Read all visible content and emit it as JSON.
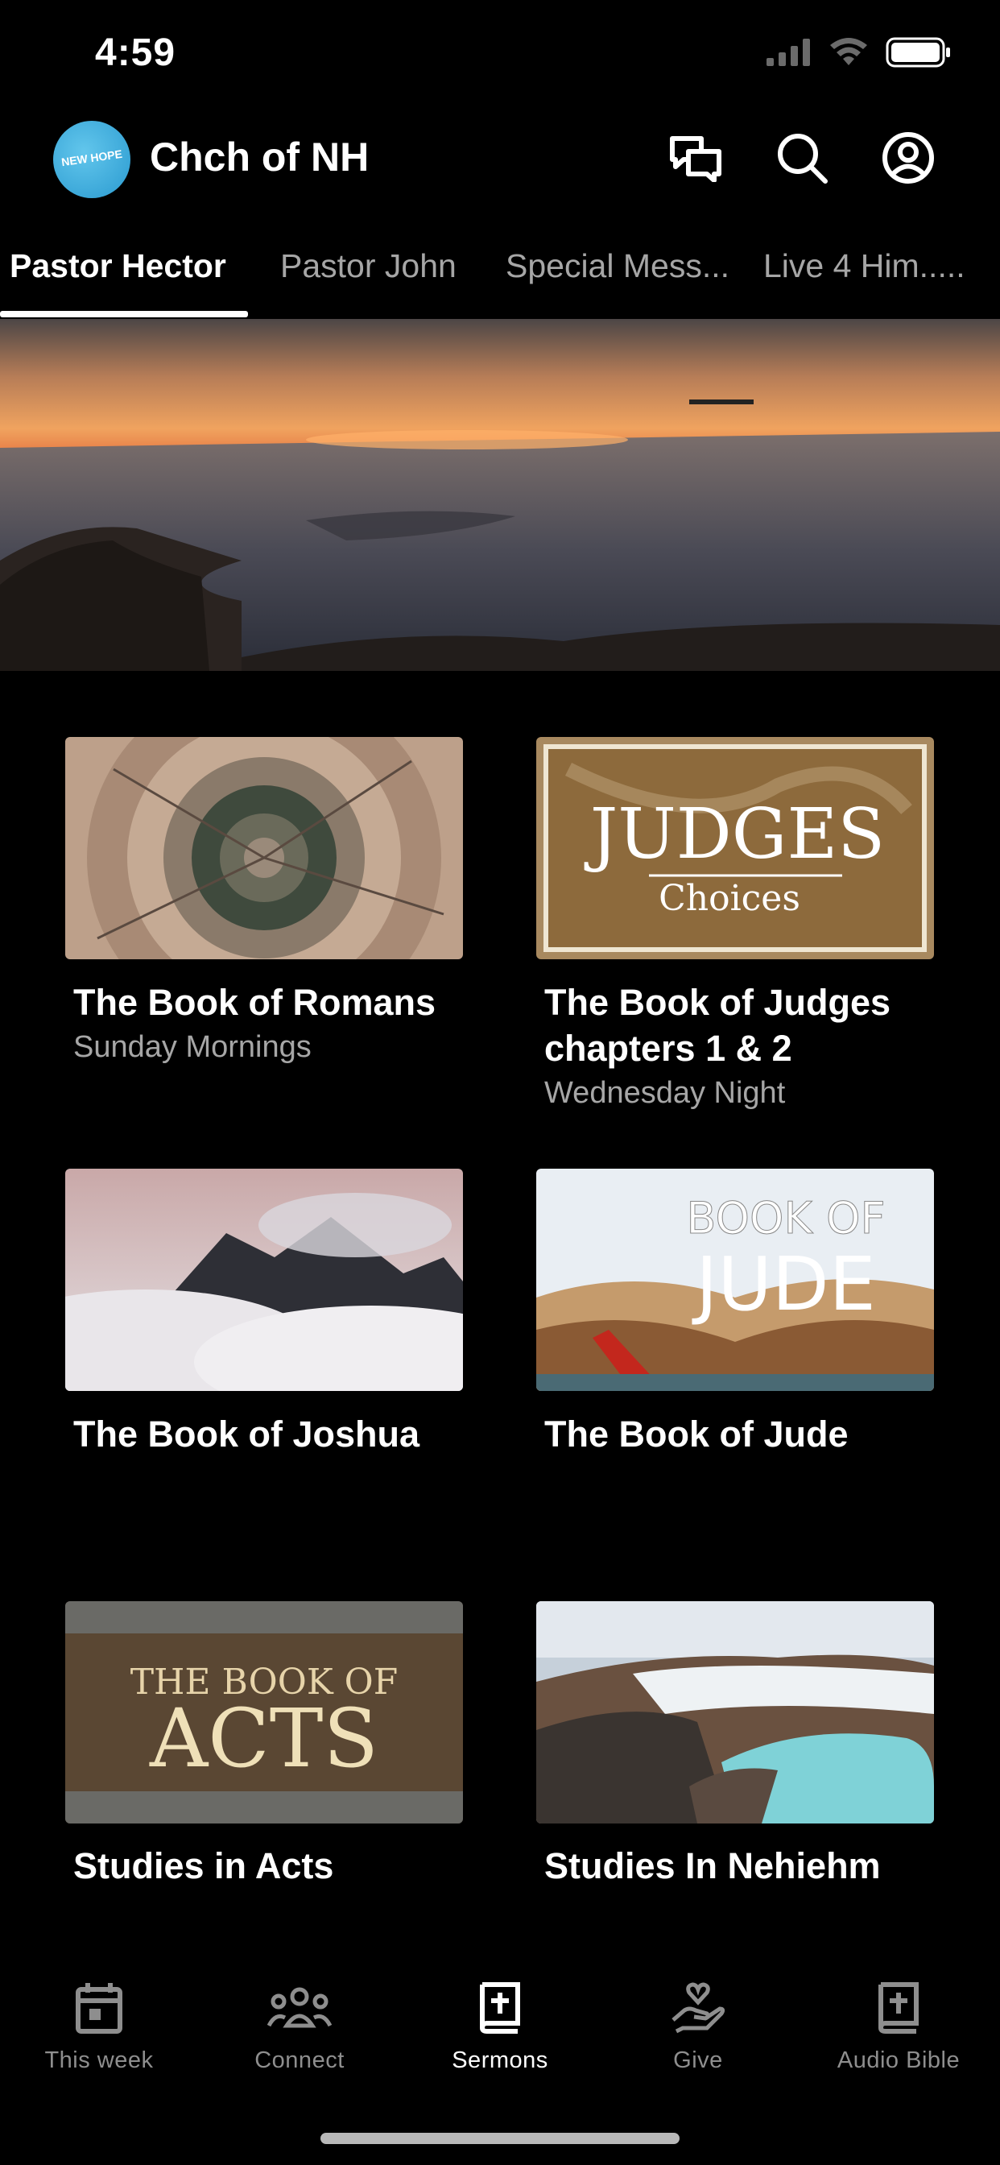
{
  "status": {
    "time": "4:59"
  },
  "header": {
    "logo_text": "NEW HOPE",
    "title": "Chch of NH"
  },
  "tabs": [
    {
      "label": "Pastor Hector"
    },
    {
      "label": "Pastor John"
    },
    {
      "label": "Special Mess..."
    },
    {
      "label": "Live 4 Him....."
    }
  ],
  "cards": [
    {
      "title": "The Book of Romans",
      "subtitle": "Sunday Mornings",
      "thumb_text": ""
    },
    {
      "title": "The Book of Judges chapters 1 & 2",
      "subtitle": "Wednesday Night",
      "thumb_text": "JUDGES",
      "thumb_subtext": "Choices"
    },
    {
      "title": "The Book of Joshua",
      "subtitle": "",
      "thumb_text": ""
    },
    {
      "title": "The Book of Jude",
      "subtitle": "",
      "thumb_text": "BOOK OF",
      "thumb_subtext": "JUDE"
    },
    {
      "title": "Studies in Acts",
      "subtitle": "",
      "thumb_text": "THE BOOK OF",
      "thumb_subtext": "ACTS"
    },
    {
      "title": "Studies In Nehiehm",
      "subtitle": "",
      "thumb_text": ""
    }
  ],
  "nav": [
    {
      "label": "This week",
      "icon": "calendar-icon",
      "active": false
    },
    {
      "label": "Connect",
      "icon": "people-icon",
      "active": false
    },
    {
      "label": "Sermons",
      "icon": "bible-icon",
      "active": true
    },
    {
      "label": "Give",
      "icon": "give-hand-heart-icon",
      "active": false
    },
    {
      "label": "Audio Bible",
      "icon": "audio-bible-icon",
      "active": false
    }
  ],
  "colors": {
    "background": "#000000",
    "accent": "#ffffff",
    "muted": "#a6a6a6",
    "logo": "#3aa7dc"
  }
}
